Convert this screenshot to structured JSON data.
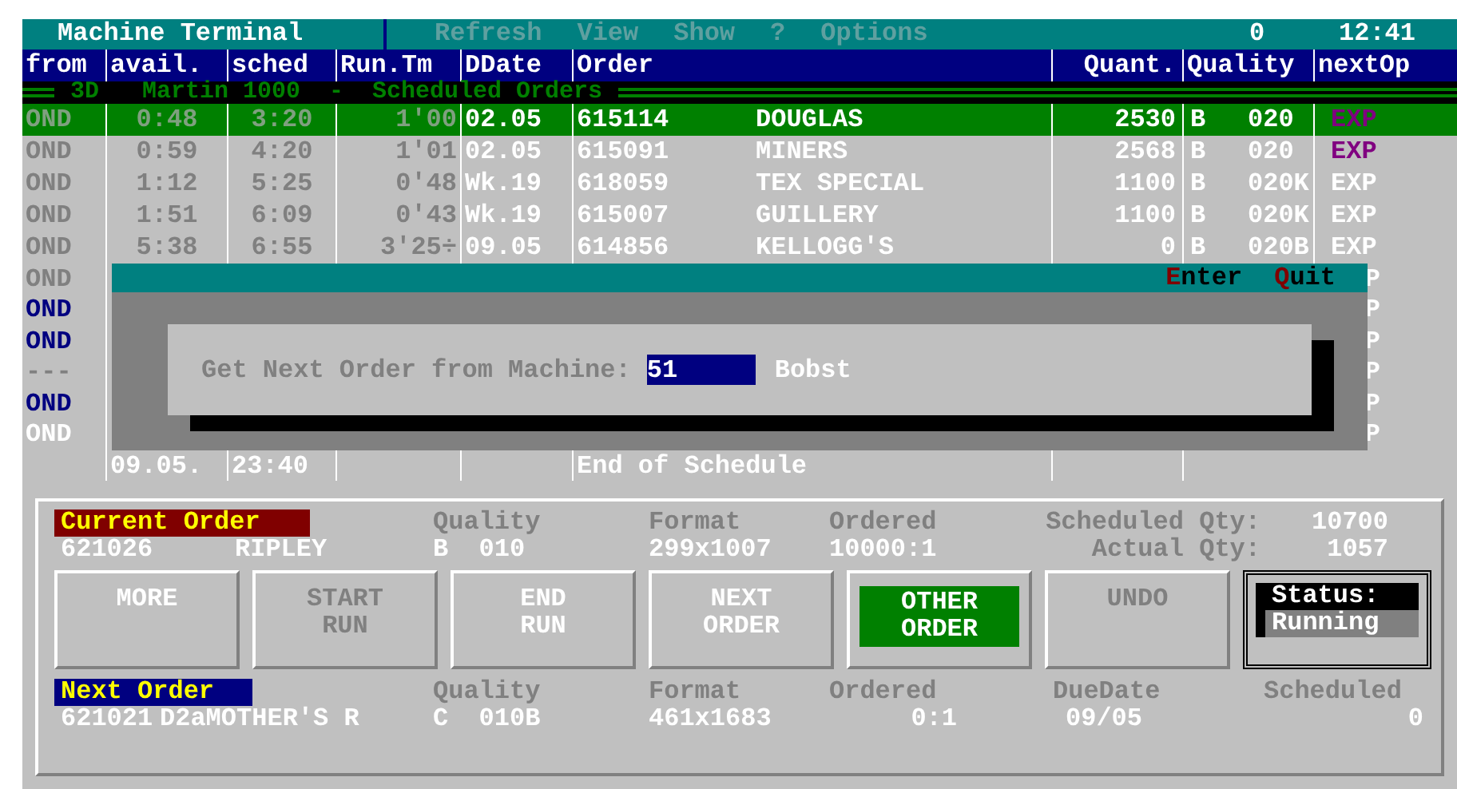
{
  "title_bar": {
    "title": "Machine Terminal",
    "menu": [
      {
        "label": "Refresh",
        "disabled": true
      },
      {
        "label": "View",
        "disabled": true
      },
      {
        "label": "Show",
        "disabled": true
      },
      {
        "label": "?",
        "disabled": true
      },
      {
        "label": "Options",
        "disabled": true
      }
    ],
    "counter": "0",
    "time": "12:41"
  },
  "table": {
    "columns": [
      "from",
      "avail.",
      "sched",
      "Run.Tm",
      "DDate",
      "Order",
      "Quant.",
      "Quality",
      "nextOp"
    ],
    "section_title": "3D   Martin 1000  -  Scheduled Orders",
    "rows": [
      {
        "selected": true,
        "from": "OND",
        "avail": "0:48",
        "sched": "3:20",
        "run_tm": "1'00",
        "ddate": "02.05",
        "order": "615114",
        "customer": "DOUGLAS",
        "quant": "2530",
        "grade": "B",
        "quality": "020",
        "next_op": {
          "text": "EXP",
          "color": "#800080"
        }
      },
      {
        "selected": false,
        "from": "OND",
        "avail": "0:59",
        "sched": "4:20",
        "run_tm": "1'01",
        "ddate": "02.05",
        "order": "615091",
        "customer": "MINERS",
        "quant": "2568",
        "grade": "B",
        "quality": "020",
        "next_op": {
          "text": "EXP",
          "color": "#800080"
        }
      },
      {
        "selected": false,
        "from": "OND",
        "avail": "1:12",
        "sched": "5:25",
        "run_tm": "0'48",
        "ddate": "Wk.19",
        "order": "618059",
        "customer": "TEX SPECIAL",
        "quant": "1100",
        "grade": "B",
        "quality": "020K",
        "next_op": {
          "text": "EXP",
          "color": "#ffffff"
        }
      },
      {
        "selected": false,
        "from": "OND",
        "avail": "1:51",
        "sched": "6:09",
        "run_tm": "0'43",
        "ddate": "Wk.19",
        "order": "615007",
        "customer": "GUILLERY",
        "quant": "1100",
        "grade": "B",
        "quality": "020K",
        "next_op": {
          "text": "EXP",
          "color": "#ffffff"
        }
      },
      {
        "selected": false,
        "from": "OND",
        "avail": "5:38",
        "sched": "6:55",
        "run_tm": "3'25÷",
        "ddate": "09.05",
        "order": "614856",
        "customer": "KELLOGG'S",
        "quant": "0",
        "grade": "B",
        "quality": "020B",
        "next_op": {
          "text": "EXP",
          "color": "#ffffff"
        }
      }
    ],
    "covered_rows": [
      {
        "from": {
          "text": "OND",
          "color": "#808080"
        },
        "next_op": "P"
      },
      {
        "from": {
          "text": "OND",
          "color": "#000080"
        },
        "next_op": "P"
      },
      {
        "from": {
          "text": "OND",
          "color": "#000080"
        },
        "next_op": "P"
      },
      {
        "from": {
          "text": "---",
          "color": "#808080"
        },
        "next_op": "P"
      },
      {
        "from": {
          "text": "OND",
          "color": "#000080"
        },
        "next_op": "P"
      },
      {
        "from": {
          "text": "OND",
          "color": "#ffffff"
        },
        "next_op": "P"
      }
    ],
    "end_row": {
      "avail": "09.05.",
      "sched": "23:40",
      "order": "End of Schedule"
    }
  },
  "dialog": {
    "actions": [
      {
        "hotkey": "E",
        "rest": "nter"
      },
      {
        "hotkey": "Q",
        "rest": "uit"
      }
    ],
    "prompt": "Get Next Order from Machine:",
    "value": "51",
    "machine": "Bobst"
  },
  "current_order": {
    "label": "Current Order",
    "order": "621026",
    "customer": "RIPLEY",
    "quality_label": "Quality",
    "quality": "B  010",
    "format_label": "Format",
    "format": "299x1007",
    "ordered_label": "Ordered",
    "ordered": "10000:1",
    "scheduled_label": "Scheduled Qty:",
    "scheduled": "10700",
    "actual_label": "Actual Qty:",
    "actual": "1057"
  },
  "buttons": [
    {
      "lines": [
        "MORE"
      ],
      "disabled": false,
      "selected": false
    },
    {
      "lines": [
        "START",
        "RUN"
      ],
      "disabled": true,
      "selected": false
    },
    {
      "lines": [
        "END",
        "RUN"
      ],
      "disabled": false,
      "selected": false
    },
    {
      "lines": [
        "NEXT",
        "ORDER"
      ],
      "disabled": false,
      "selected": false
    },
    {
      "lines": [
        "OTHER",
        "ORDER"
      ],
      "disabled": false,
      "selected": true
    },
    {
      "lines": [
        "UNDO"
      ],
      "disabled": true,
      "selected": false
    }
  ],
  "status": {
    "label": "Status:",
    "value": "Running"
  },
  "next_order": {
    "label": "Next Order",
    "order": "621021",
    "customer": "D2aMOTHER'S R",
    "quality_label": "Quality",
    "quality": "C  010B",
    "format_label": "Format",
    "format": "461x1683",
    "ordered_label": "Ordered",
    "ordered": "0:1",
    "due_label": "DueDate",
    "due": "09/05",
    "scheduled_label": "Scheduled",
    "scheduled": "0"
  }
}
